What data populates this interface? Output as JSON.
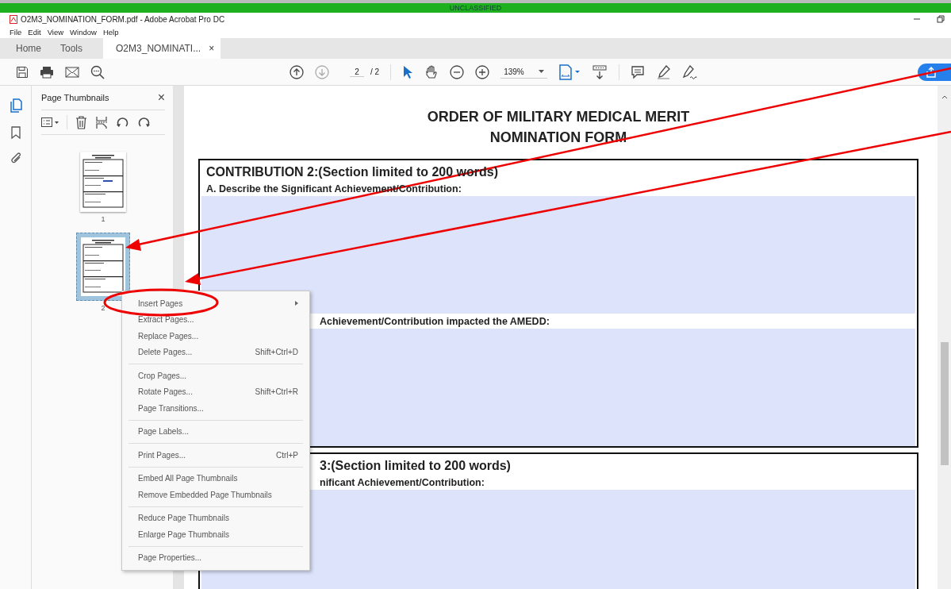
{
  "banner": {
    "text": "UNCLASSIFIED"
  },
  "window": {
    "title": "O2M3_NOMINATION_FORM.pdf - Adobe Acrobat Pro DC"
  },
  "menu": [
    "File",
    "Edit",
    "View",
    "Window",
    "Help"
  ],
  "tabs": [
    {
      "label": "Home",
      "selected": false
    },
    {
      "label": "Tools",
      "selected": false
    },
    {
      "label": "O2M3_NOMINATI...",
      "selected": true,
      "close": "×"
    }
  ],
  "toolbar": {
    "page_number": "2",
    "page_total": "/ 2",
    "zoom": "139%"
  },
  "panel": {
    "title": "Page Thumbnails",
    "close": "×",
    "thumbnails": [
      {
        "label": "1",
        "selected": false
      },
      {
        "label": "2",
        "selected": true
      }
    ]
  },
  "document": {
    "title_lines": [
      "ORDER OF MILITARY MEDICAL MERIT",
      "NOMINATION FORM"
    ],
    "sections": [
      {
        "heading": "CONTRIBUTION 2:(Section limited to 200 words)",
        "covered": false,
        "fields": [
          {
            "label": "A. Describe the Significant Achievement/Contribution:",
            "covered": false
          },
          {
            "label": "Achievement/Contribution impacted the AMEDD:",
            "covered": true
          }
        ]
      },
      {
        "heading": "3:(Section limited to 200 words)",
        "covered": true,
        "fields": [
          {
            "label": "nificant Achievement/Contribution:",
            "covered": true
          }
        ]
      }
    ]
  },
  "context_menu": {
    "groups": [
      [
        {
          "label": "Insert Pages",
          "submenu": true
        },
        {
          "label": "Extract Pages..."
        },
        {
          "label": "Replace Pages..."
        },
        {
          "label": "Delete Pages...",
          "shortcut": "Shift+Ctrl+D"
        }
      ],
      [
        {
          "label": "Crop Pages..."
        },
        {
          "label": "Rotate Pages...",
          "shortcut": "Shift+Ctrl+R"
        },
        {
          "label": "Page Transitions..."
        }
      ],
      [
        {
          "label": "Page Labels..."
        }
      ],
      [
        {
          "label": "Print Pages...",
          "shortcut": "Ctrl+P"
        }
      ],
      [
        {
          "label": "Embed All Page Thumbnails"
        },
        {
          "label": "Remove Embedded Page Thumbnails"
        }
      ],
      [
        {
          "label": "Reduce Page Thumbnails"
        },
        {
          "label": "Enlarge Page Thumbnails"
        }
      ],
      [
        {
          "label": "Page Properties..."
        }
      ]
    ]
  }
}
